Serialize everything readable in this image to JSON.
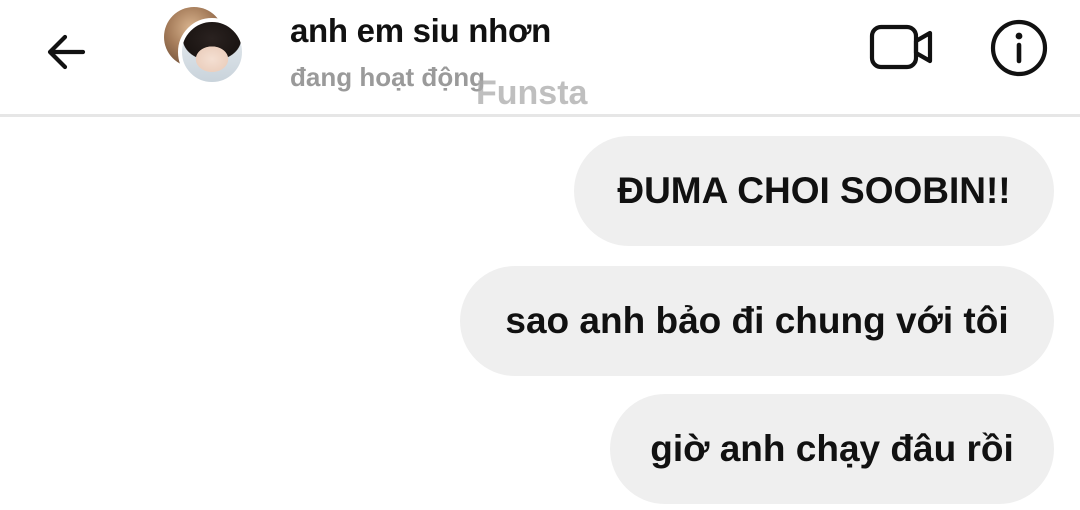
{
  "header": {
    "title": "anh em siu nhơn",
    "status": "đang hoạt động",
    "watermark": "Funsta",
    "icons": {
      "back": "arrow-left-icon",
      "video": "video-camera-icon",
      "info": "info-icon"
    }
  },
  "messages": [
    {
      "text": "ĐUMA CHOI SOOBIN!!",
      "sender": "me"
    },
    {
      "text": "sao anh bảo đi chung với tôi",
      "sender": "me"
    },
    {
      "text": "giờ anh chạy đâu rồi",
      "sender": "me"
    }
  ],
  "colors": {
    "bubble": "#efefef",
    "text": "#111111",
    "status": "#9a9a9a"
  }
}
